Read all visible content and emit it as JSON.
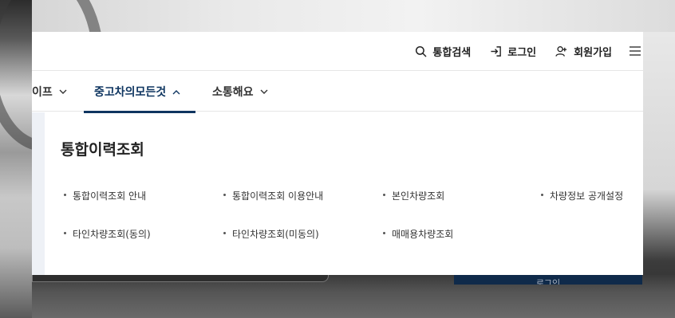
{
  "utility": {
    "search_label": "통합검색",
    "login_label": "로그인",
    "signup_label": "회원가입"
  },
  "gnb": {
    "items": [
      {
        "label": "이프"
      },
      {
        "label": "중고차의모든것"
      },
      {
        "label": "소통해요"
      }
    ]
  },
  "submenu": {
    "title": "통합이력조회",
    "links": [
      {
        "label": "통합이력조회 안내"
      },
      {
        "label": "통합이력조회 이용안내"
      },
      {
        "label": "본인차량조회"
      },
      {
        "label": "차량정보 공개설정"
      },
      {
        "label": "타인차량조회(동의)"
      },
      {
        "label": "타인차량조회(미동의)"
      },
      {
        "label": "매매용차량조회"
      }
    ]
  },
  "background": {
    "login_button_label": "로그인"
  },
  "colors": {
    "accent": "#0e3560",
    "text": "#222222",
    "panel": "#ffffff"
  }
}
